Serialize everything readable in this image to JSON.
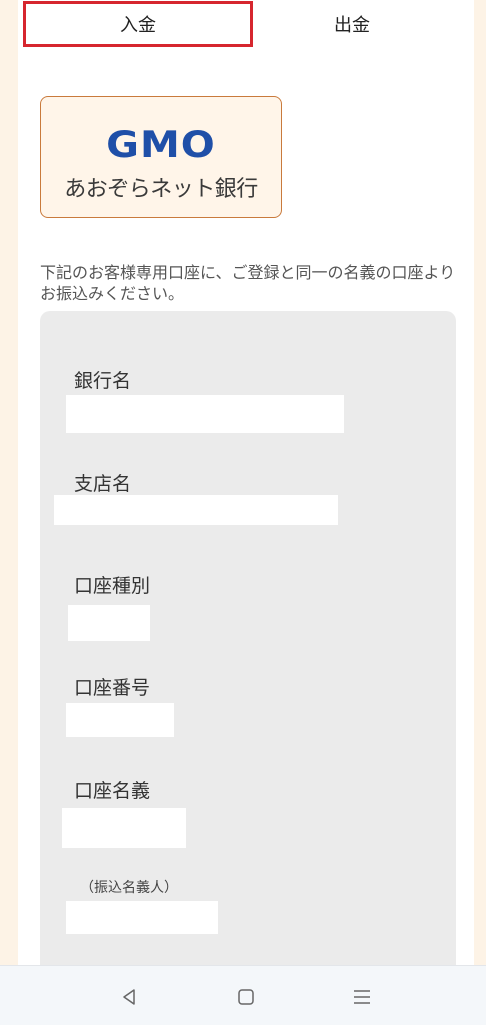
{
  "tabs": {
    "deposit": "入金",
    "withdraw": "出金"
  },
  "bank_logo": {
    "brand": "GMO",
    "name": "あおぞらネット銀行"
  },
  "instruction": "下記のお客様専用口座に、ご登録と同一の名義の口座よりお振込みください。",
  "fields": {
    "bank_name": "銀行名",
    "branch_name": "支店名",
    "account_type": "口座種別",
    "account_number": "口座番号",
    "account_holder": "口座名義",
    "transfer_name": "（振込名義人）"
  },
  "nav": {
    "icons": [
      "back-icon",
      "home-icon",
      "recent-apps-icon"
    ]
  },
  "colors": {
    "accent_red": "#d6262e",
    "gmo_blue": "#1f4fa8",
    "logo_border": "#c97a3c",
    "card_bg": "#ebebeb"
  }
}
